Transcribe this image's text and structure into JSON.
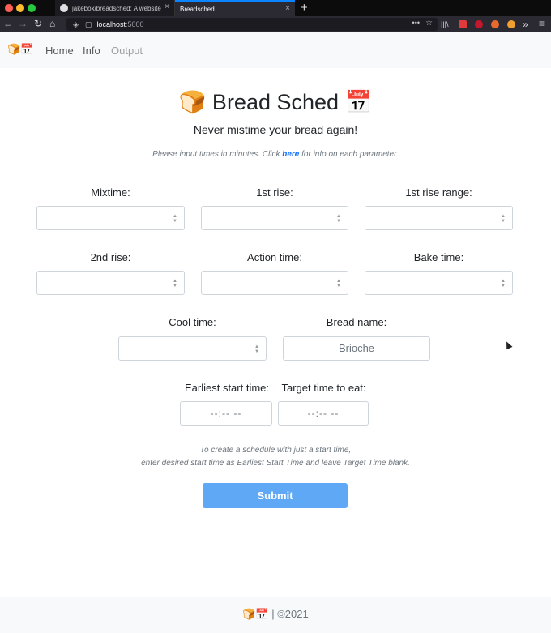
{
  "browser": {
    "tabs": [
      {
        "label": "jakebox/breadsched: A website"
      },
      {
        "label": "Breadsched"
      }
    ],
    "url_host": "localhost",
    "url_port": ":5000",
    "new_tab_label": "+",
    "close_label": "×",
    "back": "←",
    "forward": "→",
    "reload": "↻",
    "home": "⌂",
    "more": "•••",
    "star": "☆",
    "menu_icons": {
      "library": "|||\\",
      "overflow": "»",
      "hamburger": "≡"
    }
  },
  "site_nav": {
    "logo": "🍞📅",
    "links": [
      {
        "label": "Home",
        "disabled": false
      },
      {
        "label": "Info",
        "disabled": false
      },
      {
        "label": "Output",
        "disabled": true
      }
    ]
  },
  "header": {
    "title": "🍞 Bread Sched 📅",
    "subtitle": "Never mistime your bread again!",
    "instructions_pre": "Please input times in minutes. Click ",
    "instructions_link": "here",
    "instructions_post": " for info on each parameter."
  },
  "form": {
    "mixtime_label": "Mixtime:",
    "first_rise_label": "1st rise:",
    "first_rise_range_label": "1st rise range:",
    "second_rise_label": "2nd rise:",
    "action_time_label": "Action time:",
    "bake_time_label": "Bake time:",
    "cool_time_label": "Cool time:",
    "bread_name_label": "Bread name:",
    "bread_name_value": "Brioche",
    "earliest_start_label": "Earliest start time:",
    "target_time_label": "Target time to eat:",
    "time_placeholder": "--:--  --",
    "note_line1": "To create a schedule with just a start time,",
    "note_line2": "enter desired start time as Earliest Start Time and leave Target Time blank.",
    "submit_label": "Submit"
  },
  "footer": {
    "text": "🍞📅 | ©2021"
  },
  "colors": {
    "accent": "#5fa8f5",
    "link": "#0d6efd",
    "chrome_dark": "#2b2a33"
  }
}
